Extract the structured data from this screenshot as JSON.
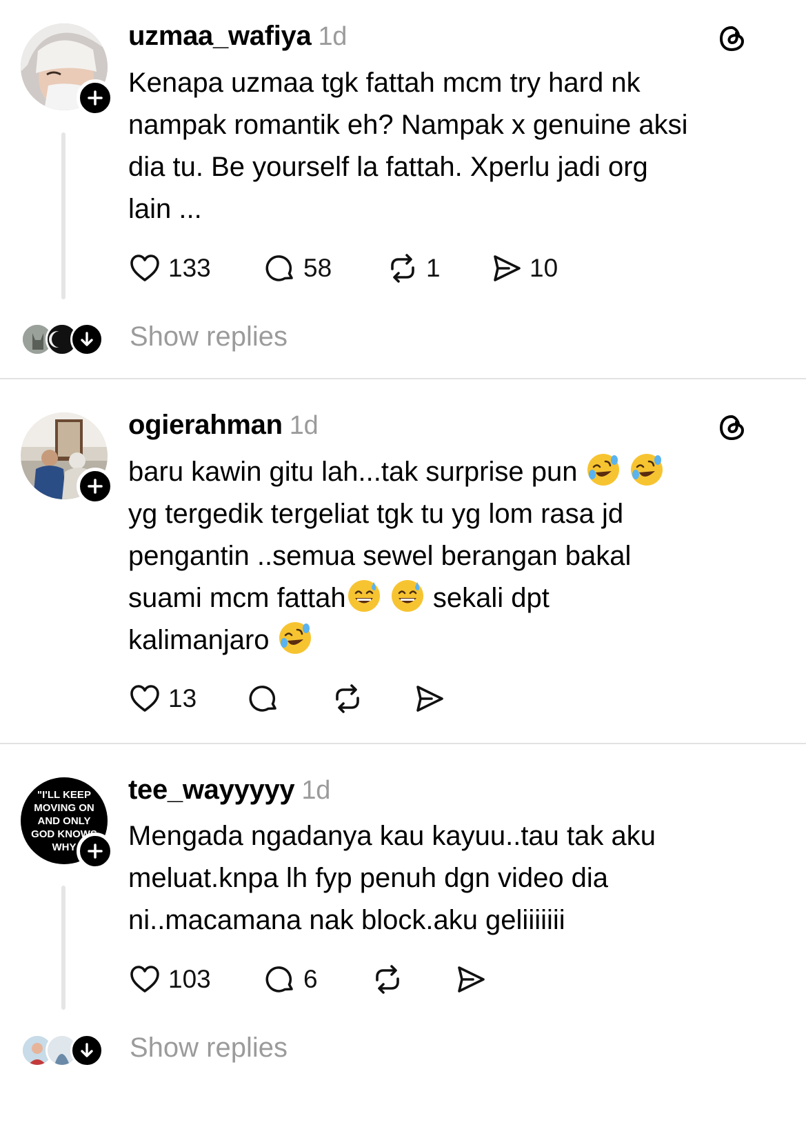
{
  "posts": [
    {
      "username": "uzmaa_wafiya",
      "time": "1d",
      "text": "Kenapa uzmaa tgk fattah mcm try hard nk\nnampak romantik eh? Nampak x genuine aksi\ndia tu. Be yourself la fattah. Xperlu jadi org\nlain ...",
      "likes": "133",
      "comments": "58",
      "reposts": "1",
      "shares": "10",
      "show_replies": "Show replies"
    },
    {
      "username": "ogierahman",
      "time": "1d",
      "line1": "baru kawin gitu lah...tak surprise pun",
      "line2": "yg tergedik tergeliat tgk tu yg lom rasa jd",
      "line3": "pengantin ..semua sewel berangan bakal",
      "line4a": "suami mcm fattah",
      "line4b": "sekali dpt",
      "line5": "kalimanjaro",
      "likes": "13"
    },
    {
      "username": "tee_wayyyyy",
      "time": "1d",
      "avatar_text": "\"I'LL KEEP\nMOVING ON\nAND ONLY\nGOD KNOWS\nWHY",
      "text": "Mengada ngadanya kau kayuu..tau tak aku\nmeluat.knpa lh fyp penuh dgn video dia\nni..macamana nak block.aku geliiiiiii",
      "likes": "103",
      "comments": "6",
      "show_replies": "Show replies"
    }
  ],
  "icons": {
    "follow": "plus-icon",
    "app": "threads-icon",
    "like": "heart-icon",
    "comment": "comment-icon",
    "repost": "repost-icon",
    "share": "send-icon",
    "expand": "arrow-down-icon"
  }
}
